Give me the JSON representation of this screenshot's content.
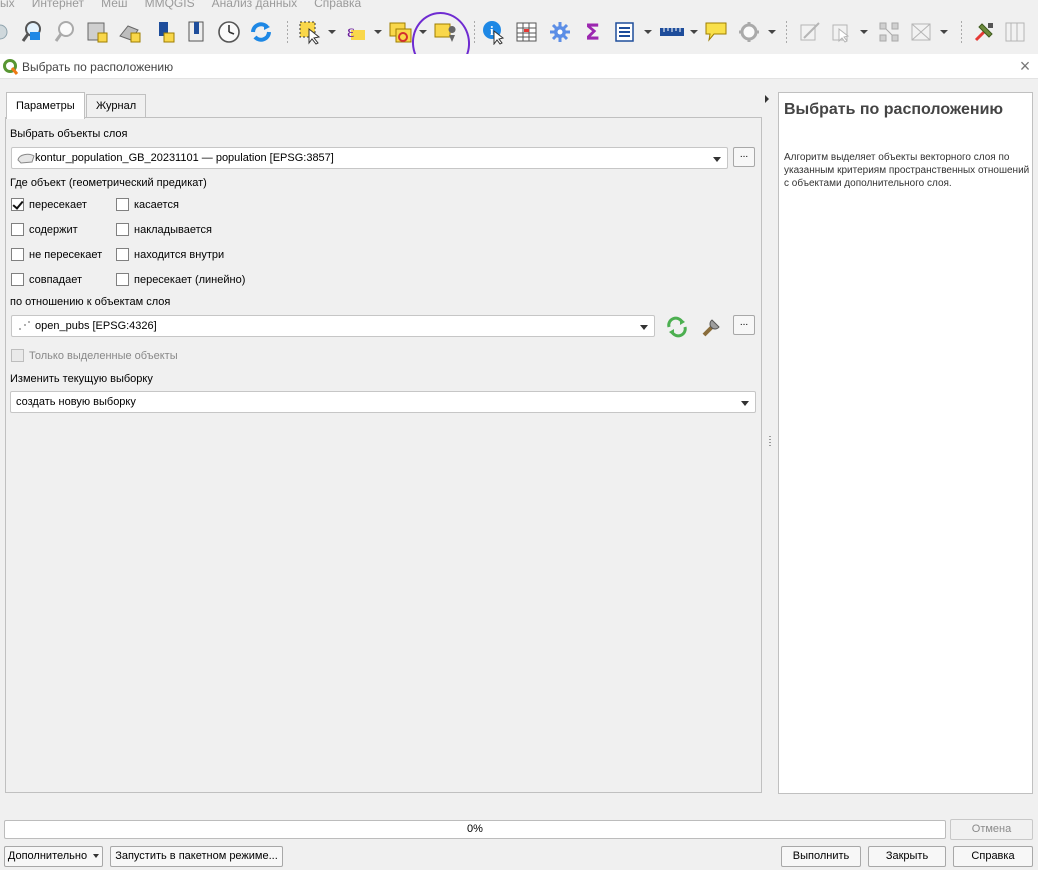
{
  "menu": [
    "ых",
    "Интернет",
    "Меш",
    "MMQGIS",
    "Анализ данных",
    "Справка"
  ],
  "toolbar": {
    "icons": [
      "zoom-layer-icon",
      "zoom-selection-icon",
      "new-bookmark-icon",
      "show-bookmarks-icon",
      "temporal-controller-icon",
      "refresh-icon",
      "select-features-icon",
      "select-by-expression-icon",
      "select-by-value-icon",
      "select-by-location-icon",
      "identify-features-icon",
      "attribute-table-icon",
      "processing-toolbox-icon",
      "statistics-icon",
      "open-field-calculator-icon",
      "measure-icon",
      "map-tips-icon",
      "locator-icon",
      "digitize-icon",
      "edit-icon",
      "vertex-tool-icon",
      "split-icon",
      "plugin-tool-icon",
      "plugin-tool-2-icon"
    ],
    "annotation_color": "#6f2bd1"
  },
  "dialog": {
    "title": "Выбрать по расположению",
    "tabs": [
      "Параметры",
      "Журнал"
    ],
    "active_tab": "Параметры",
    "select_layer_label": "Выбрать объекты слоя",
    "select_layer_value": "kontur_population_GB_20231101 — population [EPSG:3857]",
    "predicate_label": "Где объект (геометрический предикат)",
    "predicates": [
      {
        "label": "пересекает",
        "checked": true
      },
      {
        "label": "касается",
        "checked": false
      },
      {
        "label": "содержит",
        "checked": false
      },
      {
        "label": "накладывается",
        "checked": false
      },
      {
        "label": "не пересекает",
        "checked": false
      },
      {
        "label": "находится внутри",
        "checked": false
      },
      {
        "label": "совпадает",
        "checked": false
      },
      {
        "label": "пересекает (линейно)",
        "checked": false
      }
    ],
    "compare_layer_label": "по отношению к объектам слоя",
    "compare_layer_value": "open_pubs [EPSG:4326]",
    "selected_only_label": "Только выделенные объекты",
    "modify_label": "Изменить текущую выборку",
    "modify_value": "создать новую выборку",
    "ellipsis": "..."
  },
  "help": {
    "title": "Выбрать по расположению",
    "text": "Алгоритм выделяет объекты векторного слоя по указанным критериям пространственных отношений с объектами дополнительного слоя."
  },
  "footer": {
    "progress": "0%",
    "cancel": "Отмена",
    "advanced": "Дополнительно",
    "batch": "Запустить в пакетном режиме...",
    "run": "Выполнить",
    "close": "Закрыть",
    "help": "Справка"
  }
}
